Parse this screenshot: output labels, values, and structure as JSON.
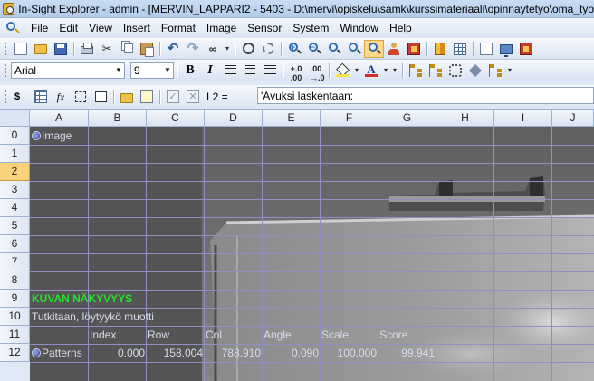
{
  "window": {
    "title": "In-Sight Explorer - admin - [MERVIN_LAPPARI2 - 5403 - D:\\mervi\\opiskelu\\samk\\kurssimateriaali\\opinnaytetyo\\oma_tyo"
  },
  "menu": [
    {
      "label": "File",
      "key": "F",
      "rest": "ile"
    },
    {
      "label": "Edit",
      "key": "E",
      "rest": "dit"
    },
    {
      "label": "View",
      "key": "V",
      "rest": "iew"
    },
    {
      "label": "Insert",
      "key": "I",
      "rest": "nsert"
    },
    {
      "label": "Format",
      "key": "",
      "rest": "Format"
    },
    {
      "label": "Image",
      "key": "",
      "rest": "Image"
    },
    {
      "label": "Sensor",
      "key": "S",
      "rest": "ensor"
    },
    {
      "label": "System",
      "key": "",
      "rest": "System"
    },
    {
      "label": "Window",
      "key": "W",
      "rest": "indow"
    },
    {
      "label": "Help",
      "key": "H",
      "rest": "elp"
    }
  ],
  "format_toolbar": {
    "font": "Arial",
    "size": "9",
    "bold_label": "B",
    "italic_label": "I",
    "font_color_label": "A"
  },
  "formula_bar": {
    "fx_label": "fx",
    "cell_ref": "L2 =",
    "value": "'Avuksi laskentaan:"
  },
  "sheet": {
    "columns": [
      "A",
      "B",
      "C",
      "D",
      "E",
      "F",
      "G",
      "H",
      "I",
      "J"
    ],
    "rows": [
      "0",
      "1",
      "2",
      "3",
      "4",
      "5",
      "6",
      "7",
      "8",
      "9",
      "10",
      "11",
      "12"
    ],
    "selected_row": "2",
    "cells": {
      "a0": "Image",
      "a9": "KUVAN NÄKYVYYS",
      "a10": "Tutkitaan, löytyykö muotti",
      "b11": "Index",
      "c11": "Row",
      "d11": "Col",
      "e11": "Angle",
      "f11": "Scale",
      "g11": "Score",
      "a12": "Patterns",
      "b12": "0.000",
      "c12": "158.004",
      "d12": "788.910",
      "e12": "0.090",
      "f12": "100.000",
      "g12": "99.941"
    },
    "colors": {
      "cell_bg": "#5c5c5c",
      "grid": "#8f8fc6",
      "highlight": "#23e22e"
    }
  }
}
